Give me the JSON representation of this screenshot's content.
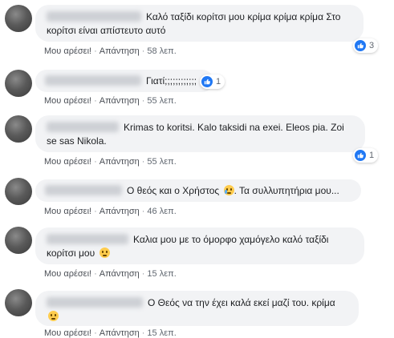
{
  "comments": [
    {
      "text": "Καλό ταξίδι κορίτσι μου κρίμα κρίμα κρίμα Στο κορίτσι είναι απίστευτο αυτό",
      "like": "Μου αρέσει!",
      "reply": "Απάντηση",
      "time": "58 λεπ.",
      "reactions": "3"
    },
    {
      "text": "Γιατί;;;;;;;;;;;;",
      "like": "Μου αρέσει!",
      "reply": "Απάντηση",
      "time": "55 λεπ.",
      "reactions": "1"
    },
    {
      "text": "Krimas to koritsi. Kalo taksidi na exei. Eleos pia. Zoi se sas Nikola.",
      "like": "Μου αρέσει!",
      "reply": "Απάντηση",
      "time": "55 λεπ.",
      "reactions": "1"
    },
    {
      "text": "Ο θεός και ο Χρήστος",
      "text_after": "Τα συλλυπητήρια μου...",
      "like": "Μου αρέσει!",
      "reply": "Απάντηση",
      "time": "46 λεπ."
    },
    {
      "text": "Καλια μου με το όμορφο χαμόγελο καλό ταξίδι κορίτσι μου",
      "like": "Μου αρέσει!",
      "reply": "Απάντηση",
      "time": "15 λεπ."
    },
    {
      "text": "Ο Θεός να την έχει καλά εκεί μαζί του. κρίμα",
      "like": "Μου αρέσει!",
      "reply": "Απάντηση",
      "time": "15 λεπ."
    }
  ],
  "icons": {
    "like": "like-thumb-icon",
    "sad": "sad-face-emoji",
    "cry": "crying-face-emoji"
  },
  "colors": {
    "like_blue": "#2078f4",
    "bubble": "#f2f3f5",
    "meta": "#606770"
  }
}
